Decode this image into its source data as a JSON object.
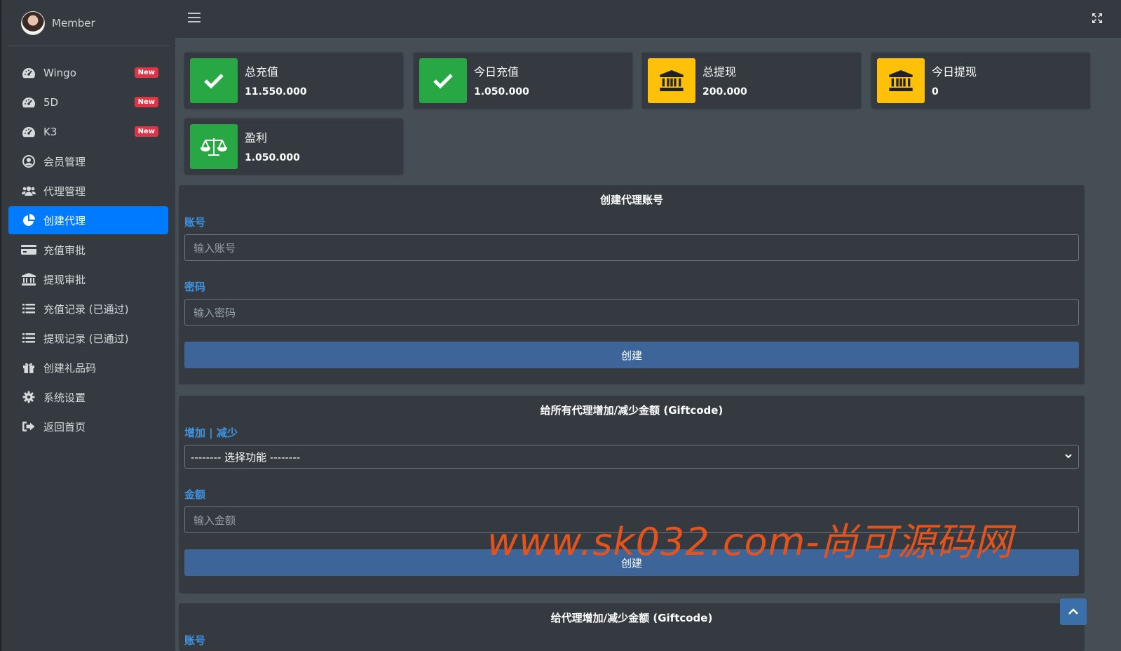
{
  "brand": {
    "user_name": "Member"
  },
  "sidebar": {
    "items": [
      {
        "label": "Wingo",
        "icon": "tachometer-icon",
        "badge": "New"
      },
      {
        "label": "5D",
        "icon": "tachometer-icon",
        "badge": "New"
      },
      {
        "label": "K3",
        "icon": "tachometer-icon",
        "badge": "New"
      },
      {
        "label": "会员管理",
        "icon": "user-circle-icon"
      },
      {
        "label": "代理管理",
        "icon": "users-icon"
      },
      {
        "label": "创建代理",
        "icon": "pie-chart-icon",
        "active": true
      },
      {
        "label": "充值审批",
        "icon": "credit-card-icon"
      },
      {
        "label": "提现审批",
        "icon": "bank-icon"
      },
      {
        "label": "充值记录 (已通过)",
        "icon": "list-icon"
      },
      {
        "label": "提现记录 (已通过)",
        "icon": "list-icon"
      },
      {
        "label": "创建礼品码",
        "icon": "gift-icon"
      },
      {
        "label": "系统设置",
        "icon": "gear-icon"
      },
      {
        "label": "返回首页",
        "icon": "sign-out-icon"
      }
    ]
  },
  "stats": [
    {
      "label": "总充值",
      "value": "11.550.000",
      "icon": "check-icon",
      "color": "#28a745"
    },
    {
      "label": "今日充值",
      "value": "1.050.000",
      "icon": "check-icon",
      "color": "#28a745"
    },
    {
      "label": "总提现",
      "value": "200.000",
      "icon": "bank-icon",
      "color": "#ffc107"
    },
    {
      "label": "今日提现",
      "value": "0",
      "icon": "bank-icon",
      "color": "#ffc107"
    },
    {
      "label": "盈利",
      "value": "1.050.000",
      "icon": "balance-scale-icon",
      "color": "#28a745"
    }
  ],
  "create_agent": {
    "title": "创建代理账号",
    "account_label": "账号",
    "account_placeholder": "输入账号",
    "password_label": "密码",
    "password_placeholder": "输入密码",
    "submit_label": "创建"
  },
  "all_agents_giftcode": {
    "title": "给所有代理增加/减少金额 (Giftcode)",
    "mode_label": "增加 | 减少",
    "mode_selected": "-------- 选择功能 --------",
    "amount_label": "金额",
    "amount_placeholder": "输入金额",
    "submit_label": "创建"
  },
  "agent_giftcode": {
    "title": "给代理增加/减少金额 (Giftcode)",
    "account_label": "账号"
  },
  "watermark": "www.sk032.com-尚可源码网",
  "colors": {
    "accent": "#007bff",
    "label_blue": "#3f93e0",
    "button": "#3e6599",
    "success": "#28a745",
    "warning": "#ffc107",
    "badge": "#dc3545"
  }
}
